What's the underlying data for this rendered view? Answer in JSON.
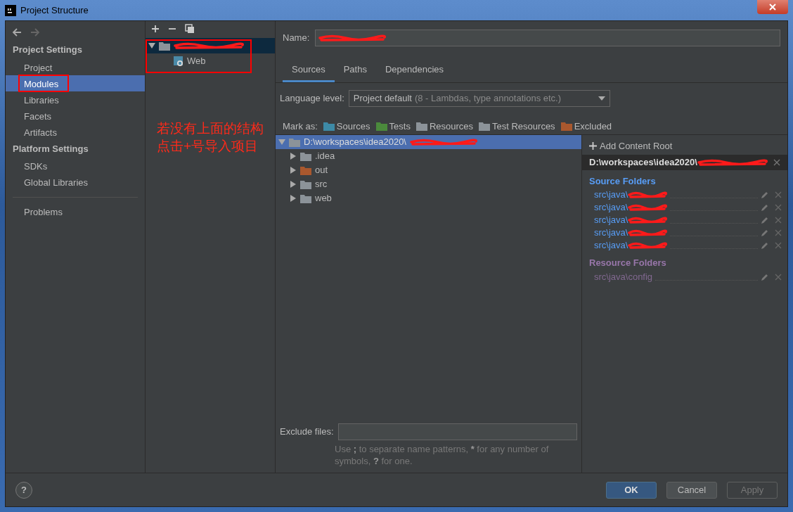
{
  "window": {
    "title": "Project Structure"
  },
  "sidebar": {
    "sections": [
      {
        "title": "Project Settings",
        "items": [
          {
            "label": "Project",
            "selected": false,
            "annotated": false
          },
          {
            "label": "Modules",
            "selected": true,
            "annotated": true
          },
          {
            "label": "Libraries",
            "selected": false,
            "annotated": false
          },
          {
            "label": "Facets",
            "selected": false,
            "annotated": false
          },
          {
            "label": "Artifacts",
            "selected": false,
            "annotated": false
          }
        ]
      },
      {
        "title": "Platform Settings",
        "items": [
          {
            "label": "SDKs",
            "selected": false,
            "annotated": false
          },
          {
            "label": "Global Libraries",
            "selected": false,
            "annotated": false
          }
        ]
      },
      {
        "items": [
          {
            "label": "Problems",
            "selected": false,
            "annotated": false
          }
        ]
      }
    ]
  },
  "module_tree": {
    "root": {
      "redacted": true,
      "expanded": true,
      "children": [
        {
          "label": "Web"
        }
      ]
    }
  },
  "annotation": {
    "lines": [
      "若没有上面的结构",
      "点击+号导入项目"
    ]
  },
  "name_field": {
    "label": "Name:",
    "redacted": true
  },
  "tabs": [
    {
      "label": "Sources",
      "selected": true
    },
    {
      "label": "Paths",
      "selected": false
    },
    {
      "label": "Dependencies",
      "selected": false
    }
  ],
  "language_level": {
    "label": "Language level:",
    "value": "Project default",
    "detail": "(8 - Lambdas, type annotations etc.)"
  },
  "mark_as": {
    "label": "Mark as:",
    "options": [
      {
        "label": "Sources",
        "color": "#3d8aa6"
      },
      {
        "label": "Tests",
        "color": "#4b8a3c"
      },
      {
        "label": "Resources",
        "color": "#8c9399"
      },
      {
        "label": "Test Resources",
        "color": "#8c9399"
      },
      {
        "label": "Excluded",
        "color": "#a9582e"
      }
    ]
  },
  "file_tree": {
    "root": {
      "label": "D:\\workspaces\\idea2020\\",
      "redacted": true,
      "selected": true,
      "expanded": true,
      "children": [
        {
          "label": ".idea",
          "color": "#8c9399"
        },
        {
          "label": "out",
          "color": "#a9582e"
        },
        {
          "label": "src",
          "color": "#8c9399"
        },
        {
          "label": "web",
          "color": "#8c9399"
        }
      ]
    }
  },
  "content_root": {
    "add_label": "Add Content Root",
    "path": "D:\\workspaces\\idea2020\\",
    "redacted": true,
    "groups": [
      {
        "title": "Source Folders",
        "color": "#589df6",
        "folders": [
          "src\\java\\",
          "src\\java\\",
          "src\\java\\",
          "src\\java\\",
          "src\\java\\"
        ],
        "redacted": true
      },
      {
        "title": "Resource Folders",
        "color": "#9876aa",
        "folders": [
          "src\\java\\config"
        ],
        "redacted": false
      }
    ]
  },
  "exclude_files": {
    "label": "Exclude files:",
    "hint": "Use **;** to separate name patterns, ***** for any number of symbols, **?** for one."
  },
  "buttons": [
    {
      "label": "OK",
      "kind": "default",
      "disabled": false
    },
    {
      "label": "Cancel",
      "kind": "normal",
      "disabled": false
    },
    {
      "label": "Apply",
      "kind": "normal",
      "disabled": true
    }
  ],
  "help": {
    "label": "?"
  }
}
